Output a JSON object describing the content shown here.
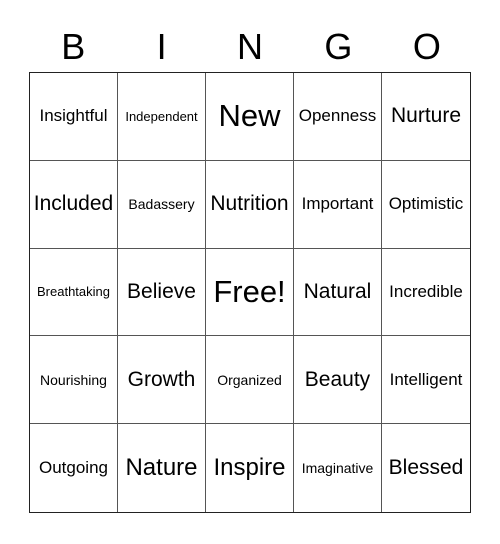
{
  "header": [
    "B",
    "I",
    "N",
    "G",
    "O"
  ],
  "cells": [
    "Insightful",
    "Independent",
    "New",
    "Openness",
    "Nurture",
    "Included",
    "Badassery",
    "Nutrition",
    "Important",
    "Optimistic",
    "Breathtaking",
    "Believe",
    "Free!",
    "Natural",
    "Incredible",
    "Nourishing",
    "Growth",
    "Organized",
    "Beauty",
    "Intelligent",
    "Outgoing",
    "Nature",
    "Inspire",
    "Imaginative",
    "Blessed"
  ]
}
